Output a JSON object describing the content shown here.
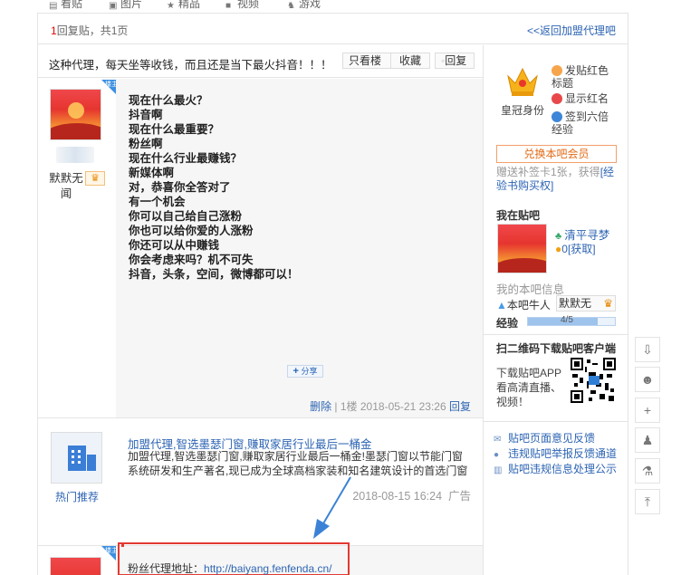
{
  "tabs": [
    {
      "icon": "post-icon",
      "label": "看贴"
    },
    {
      "icon": "image-icon",
      "label": "图片"
    },
    {
      "icon": "star-icon",
      "label": "精品"
    },
    {
      "icon": "video-icon",
      "label": "视频"
    },
    {
      "icon": "game-icon",
      "label": "游戏"
    }
  ],
  "replybar": {
    "count_num": "1",
    "count_text": "回复贴，共1页",
    "back_link": "<<返回加盟代理吧"
  },
  "thread": {
    "title": "这种代理，每天坐等收钱，而且还是当下最火抖音！！！",
    "only_op_label": "只看楼主",
    "collect_label": "收藏",
    "reply_label": "回复"
  },
  "post": {
    "corner_badge": "楼主",
    "username": "默默无闻",
    "level_glyph": "♛",
    "lines": [
      "现在什么最火？",
      "抖音啊",
      "现在什么最重要？",
      "粉丝啊",
      "现在什么行业最赚钱？",
      "新媒体啊",
      "对，恭喜你全答对了",
      "有一个机会",
      "你可以自己给自己涨粉",
      "你也可以给你爱的人涨粉",
      "你还可以从中赚钱",
      "你会考虑来吗？机不可失",
      "抖音，头条，空间，微博都可以！"
    ],
    "share_label": "分享",
    "delete_label": "删除",
    "floor_info": "1楼 2018-05-21 23:26",
    "reply_label": "回复"
  },
  "ad": {
    "icon_label": "热门推荐",
    "title": "加盟代理,智选墨瑟门窗,赚取家居行业最后一桶金",
    "desc": "加盟代理,智选墨瑟门窗,赚取家居行业最后一桶金!墨瑟门窗以节能门窗系统研发和生产著名,现已成为全球高档家装和知名建筑设计的首选门窗",
    "time": "2018-08-15 16:24",
    "tag": "广告"
  },
  "bottom_post": {
    "corner_badge": "楼主",
    "addr_label": "粉丝代理地址：",
    "addr_link": "http://baiyang.fenfenda.cn/"
  },
  "sidebar": {
    "identity_label": "皇冠身份",
    "privileges": [
      "发贴红色标题",
      "显示红名",
      "签到六倍经验"
    ],
    "vip_button": "兑换本吧会员",
    "gift_text": "赠送补签卡1张，获得",
    "gift_link": "[经验书购买权]",
    "my_header": "我在贴吧",
    "my_name": "清平寻梦",
    "my_coins": "0",
    "my_coins_link": "[获取]",
    "bar_info_label": "我的本吧信息",
    "niuren_label": "本吧牛人",
    "niuren_name": "默默无",
    "exp_label": "经验",
    "exp_text": "4/5",
    "exp_value": 0.8,
    "app_header": "扫二维码下载贴吧客户端",
    "app_desc": "下载贴吧APP看高清直播、视频！",
    "links": [
      "贴吧页面意见反馈",
      "违规贴吧举报反馈通道",
      "贴吧违规信息处理公示"
    ]
  },
  "float_buttons": [
    "download-icon",
    "face-icon",
    "plus-icon",
    "user-icon",
    "lab-icon",
    "top-icon"
  ],
  "colors": {
    "link": "#2d64b3",
    "accent_red": "#e23a32",
    "vip_orange": "#e36b17"
  }
}
